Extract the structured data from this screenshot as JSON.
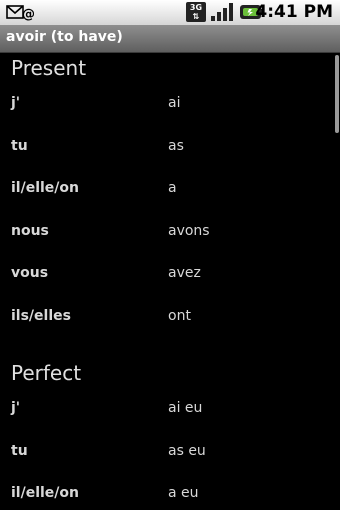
{
  "status_bar": {
    "time": "4:41 PM",
    "network": "3G",
    "icons": [
      "email-notification-icon",
      "3g-icon",
      "signal-icon",
      "battery-icon"
    ]
  },
  "title_bar": {
    "title": "avoir (to have)"
  },
  "sections": [
    {
      "title": "Present",
      "rows": [
        {
          "pronoun": "j'",
          "form": "ai"
        },
        {
          "pronoun": "tu",
          "form": "as"
        },
        {
          "pronoun": "il/elle/on",
          "form": "a"
        },
        {
          "pronoun": "nous",
          "form": "avons"
        },
        {
          "pronoun": "vous",
          "form": "avez"
        },
        {
          "pronoun": "ils/elles",
          "form": "ont"
        }
      ]
    },
    {
      "title": "Perfect",
      "rows": [
        {
          "pronoun": "j'",
          "form": "ai eu"
        },
        {
          "pronoun": "tu",
          "form": "as eu"
        },
        {
          "pronoun": "il/elle/on",
          "form": "a eu"
        }
      ]
    }
  ]
}
